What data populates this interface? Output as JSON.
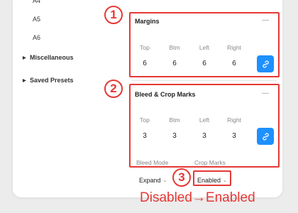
{
  "sidebar": {
    "items": [
      {
        "label": "A4",
        "bold": false,
        "expandable": false
      },
      {
        "label": "A5",
        "bold": false,
        "expandable": false
      },
      {
        "label": "A6",
        "bold": false,
        "expandable": false
      },
      {
        "label": "Miscellaneous",
        "bold": true,
        "expandable": true
      },
      {
        "label": "Saved Presets",
        "bold": true,
        "expandable": true
      }
    ]
  },
  "margins": {
    "title": "Margins",
    "collapse_glyph": "—",
    "labels": [
      "Top",
      "Btm",
      "Left",
      "Right"
    ],
    "values": [
      "6",
      "6",
      "6",
      "6"
    ],
    "link_icon": "link-icon"
  },
  "bleed": {
    "title": "Bleed & Crop Marks",
    "collapse_glyph": "—",
    "labels": [
      "Top",
      "Btm",
      "Left",
      "Right"
    ],
    "values": [
      "3",
      "3",
      "3",
      "3"
    ],
    "link_icon": "link-icon",
    "bleed_mode_label": "Bleed Mode",
    "crop_marks_label": "Crop Marks",
    "bleed_mode_value": "Expand",
    "crop_marks_value": "Enabled"
  },
  "annotations": {
    "badges": [
      "1",
      "2",
      "3"
    ],
    "caption": "Disabled→Enabled",
    "color": "#e53935"
  },
  "accent_color": "#1e90ff"
}
